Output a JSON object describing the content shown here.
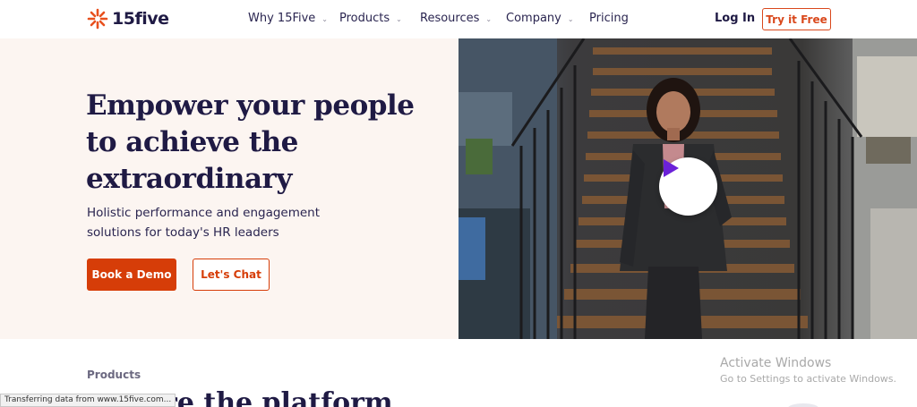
{
  "header": {
    "logo_text": "15five",
    "nav": [
      {
        "label": "Why 15Five",
        "has_dropdown": true
      },
      {
        "label": "Products",
        "has_dropdown": true
      },
      {
        "label": "Resources",
        "has_dropdown": true
      },
      {
        "label": "Company",
        "has_dropdown": true
      },
      {
        "label": "Pricing",
        "has_dropdown": false
      }
    ],
    "login_label": "Log In",
    "try_label": "Try it Free"
  },
  "hero": {
    "title": "Empower your people to achieve the extraordinary",
    "subtitle": "Holistic performance and engagement solutions for today's HR leaders",
    "demo_label": "Book a Demo",
    "chat_label": "Let's Chat",
    "video_icon": "play-icon"
  },
  "products_section": {
    "label": "Products",
    "heading": "ore the platform"
  },
  "os_overlay": {
    "activate_title": "Activate Windows",
    "activate_sub": "Go to Settings to activate Windows."
  },
  "status_bar": {
    "text": "Transferring data from www.15five.com..."
  },
  "colors": {
    "brand": "#d63d08",
    "navy": "#1f1a44",
    "hero_bg": "#fcf5f1",
    "play_icon": "#6b21d8"
  }
}
